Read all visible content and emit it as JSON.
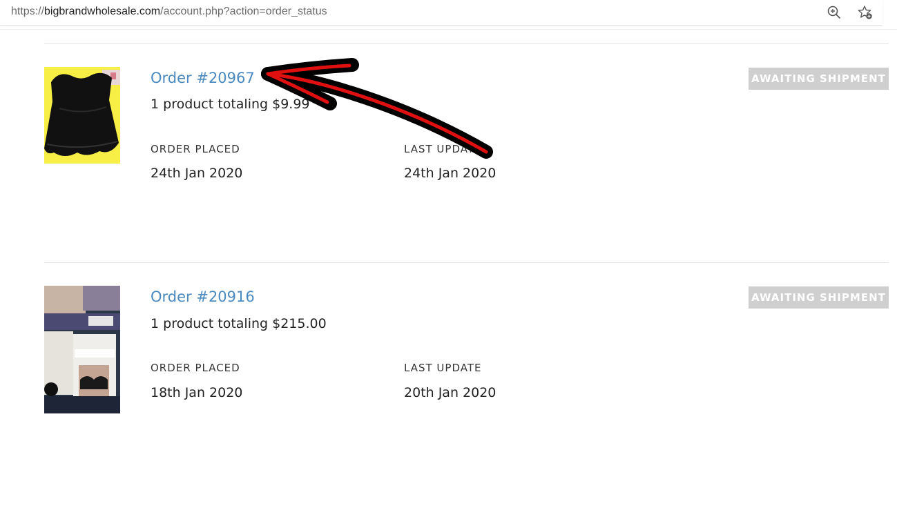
{
  "address_bar": {
    "url_prefix": "https://",
    "url_host": "bigbrandwholesale.com",
    "url_path": "/account.php?action=order_status",
    "zoom_icon": "zoom-in-icon",
    "favorite_icon": "add-favorite-icon"
  },
  "orders": [
    {
      "title": "Order #20967",
      "summary": "1 product totaling $9.99",
      "placed_label": "ORDER PLACED",
      "placed_date": "24th Jan 2020",
      "updated_label": "LAST UPDATE",
      "updated_date": "24th Jan 2020",
      "status": "AWAITING SHIPMENT"
    },
    {
      "title": "Order #20916",
      "summary": "1 product totaling $215.00",
      "placed_label": "ORDER PLACED",
      "placed_date": "18th Jan 2020",
      "updated_label": "LAST UPDATE",
      "updated_date": "20th Jan 2020",
      "status": "AWAITING SHIPMENT"
    }
  ],
  "colors": {
    "link": "#4a8ac0",
    "status_badge": "#cfcfcf",
    "annotation_arrow": "#e01010"
  }
}
